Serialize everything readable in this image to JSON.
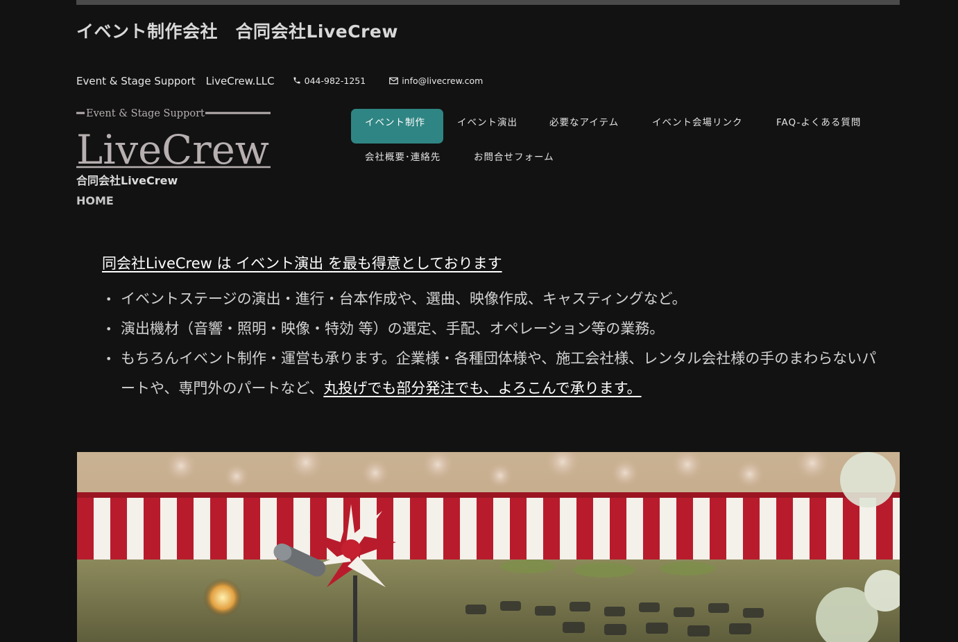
{
  "header": {
    "site_title": "イベント制作会社　合同会社LiveCrew",
    "tagline": "Event & Stage Support　LiveCrew.LLC",
    "phone": "044-982-1251",
    "email": "info@livecrew.com"
  },
  "logo": {
    "top_text": "Event & Stage Support",
    "main_text": "LiveCrew",
    "subtitle": "合同会社LiveCrew"
  },
  "breadcrumb": "HOME",
  "nav": {
    "items": [
      {
        "label": "イベント制作",
        "active": true
      },
      {
        "label": "イベント演出",
        "active": false
      },
      {
        "label": "必要なアイテム",
        "active": false
      },
      {
        "label": "イベント会場リンク",
        "active": false
      },
      {
        "label": "FAQ-よくある質問",
        "active": false
      },
      {
        "label": "会社概要･連絡先",
        "active": false
      },
      {
        "label": "お問合せフォーム",
        "active": false
      }
    ]
  },
  "content": {
    "headline": "同会社LiveCrew は イベント演出 を最も得意としております",
    "bullets": [
      "イベントステージの演出・進行・台本作成や、選曲、映像作成、キャスティングなど。",
      "演出機材（音響・照明・映像・特効 等）の選定、手配、オペレーション等の業務。",
      "もちろんイベント制作・運営も承ります。企業様・各種団体様や、施工会社様、レンタル会社様の手のまわらないパートや、専門外のパートなど、"
    ],
    "bullet_link": "丸投げでも部分発注でも、よろこんで承ります。"
  },
  "hero": {
    "accent_red": "#b81c2c",
    "accent_white": "#f4f0ea"
  }
}
